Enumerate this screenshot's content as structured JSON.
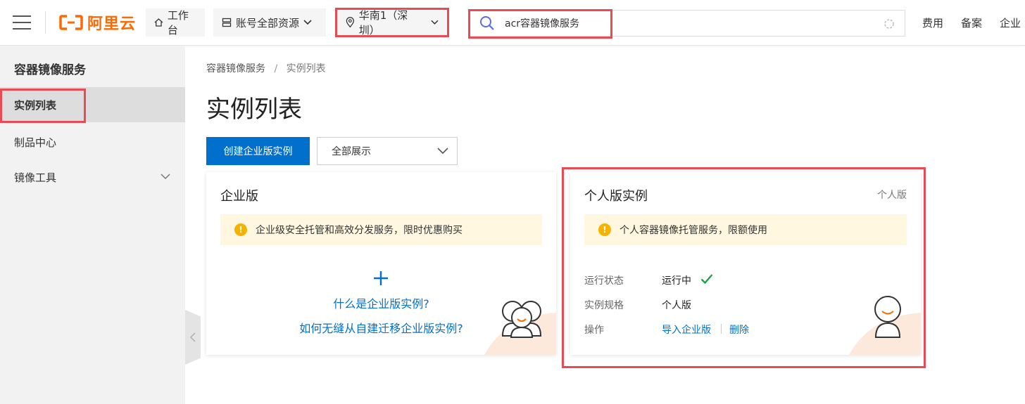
{
  "topbar": {
    "logo_text": "阿里云",
    "workbench": "工作台",
    "resources": "账号全部资源",
    "region": "华南1（深圳）",
    "search_value": "acr容器镜像服务",
    "nav": [
      "费用",
      "备案",
      "企业"
    ]
  },
  "sidebar": {
    "title": "容器镜像服务",
    "items": [
      {
        "label": "实例列表"
      },
      {
        "label": "制品中心"
      },
      {
        "label": "镜像工具"
      }
    ]
  },
  "main": {
    "breadcrumb": {
      "root": "容器镜像服务",
      "sep": "/",
      "current": "实例列表"
    },
    "title": "实例列表",
    "create_button": "创建企业版实例",
    "filter_value": "全部展示",
    "enterprise_card": {
      "title": "企业版",
      "notice": "企业级安全托管和高效分发服务，限时优惠购买",
      "link1": "什么是企业版实例?",
      "link2": "如何无缝从自建迁移企业版实例?"
    },
    "personal_card": {
      "title": "个人版实例",
      "tag": "个人版",
      "notice": "个人容器镜像托管服务，限额使用",
      "status_label": "运行状态",
      "status_value": "运行中",
      "spec_label": "实例规格",
      "spec_value": "个人版",
      "ops_label": "操作",
      "op_import": "导入企业版",
      "op_delete": "删除"
    }
  },
  "colors": {
    "brand": "#ff6a00",
    "primary": "#0070cc",
    "highlight": "#e94b55",
    "success": "#1aa34a",
    "warning": "#f5b300"
  }
}
